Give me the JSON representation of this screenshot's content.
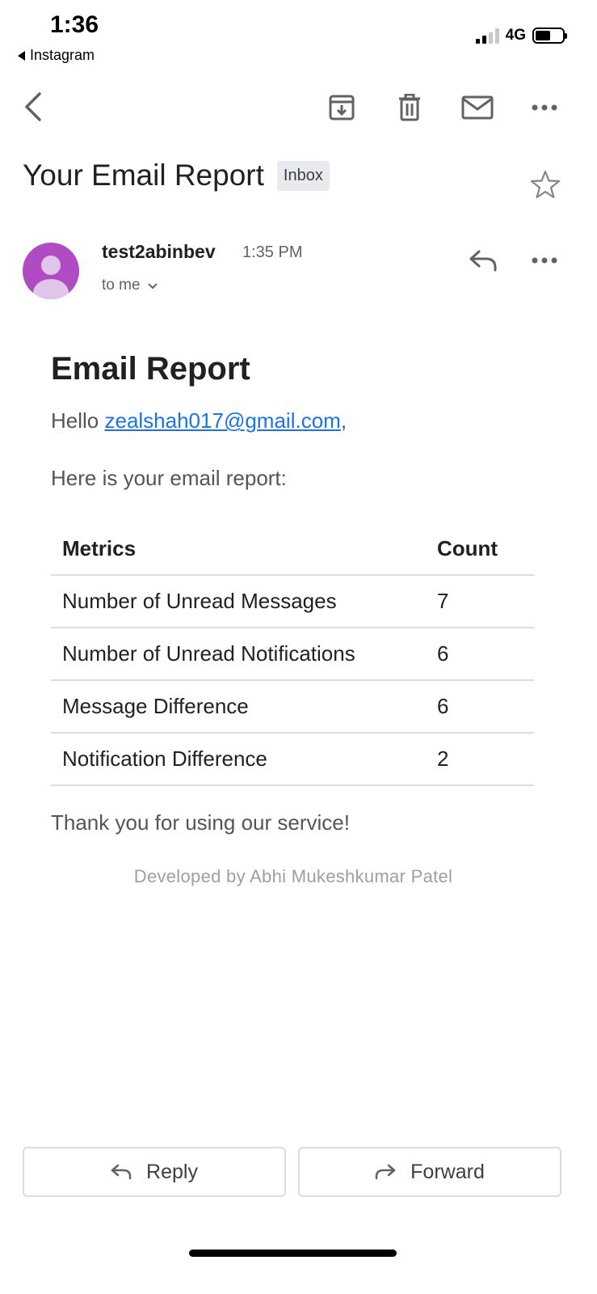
{
  "status_bar": {
    "time": "1:36",
    "back_app": "Instagram",
    "network": "4G"
  },
  "toolbar": {
    "icons": [
      "back-icon",
      "archive-icon",
      "delete-icon",
      "mark-unread-icon",
      "more-icon"
    ]
  },
  "email": {
    "subject": "Your Email Report",
    "label": "Inbox",
    "sender": "test2abinbev",
    "time": "1:35 PM",
    "recipient": "to me",
    "avatar_color": "#b04bc4"
  },
  "body": {
    "title": "Email Report",
    "greeting_prefix": "Hello ",
    "greeting_email": "zealshah017@gmail.com",
    "greeting_suffix": ",",
    "intro": "Here is your email report:",
    "table": {
      "headers": [
        "Metrics",
        "Count"
      ],
      "rows": [
        [
          "Number of Unread Messages",
          "7"
        ],
        [
          "Number of Unread Notifications",
          "6"
        ],
        [
          "Message Difference",
          "6"
        ],
        [
          "Notification Difference",
          "2"
        ]
      ]
    },
    "thanks": "Thank you for using our service!",
    "credit": "Developed by Abhi Mukeshkumar Patel"
  },
  "actions": {
    "reply_label": "Reply",
    "forward_label": "Forward"
  },
  "colors": {
    "link": "#1a73e8",
    "chip_bg": "#e8eaed",
    "icon": "#5f6368"
  }
}
